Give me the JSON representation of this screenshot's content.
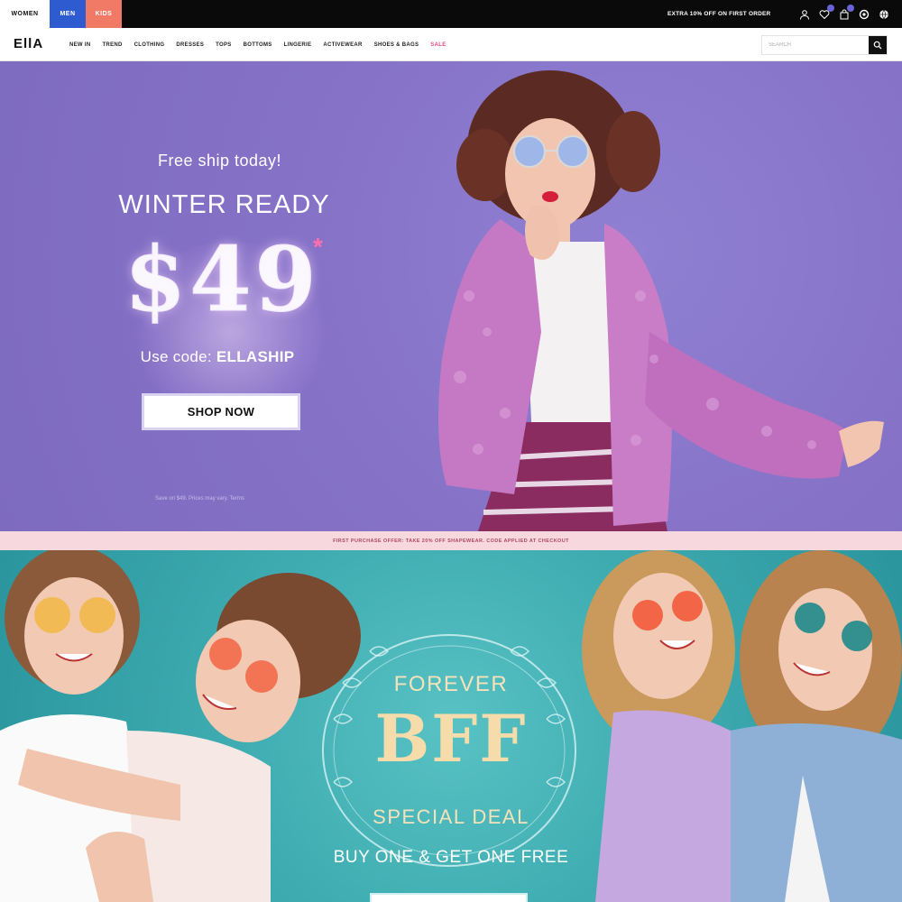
{
  "topbar": {
    "tabs": [
      {
        "label": "WOMEN",
        "color": "#ffffff"
      },
      {
        "label": "MEN",
        "color": "#2f5bd1"
      },
      {
        "label": "KIDS",
        "color": "#f07a66"
      }
    ],
    "promo": "EXTRA 10% OFF ON FIRST ORDER",
    "icons": [
      "user-icon",
      "heart-icon",
      "cart-icon",
      "headset-icon",
      "globe-icon"
    ]
  },
  "nav": {
    "logo": "EllA",
    "links": [
      "NEW IN",
      "TREND",
      "CLOTHING",
      "DRESSES",
      "TOPS",
      "BOTTOMS",
      "LINGERIE",
      "ACTIVEWEAR",
      "SHOES & BAGS",
      "SALE"
    ],
    "search_placeholder": "SEARCH"
  },
  "hero": {
    "subtitle": "Free ship today!",
    "title": "WINTER READY",
    "price": "$49",
    "price_mark": "*",
    "code_label": "Use code:",
    "code": "ELLASHIP",
    "button": "SHOP NOW",
    "fineprint": "Save on $49. Prices may vary. Terms",
    "accent": "#8673c8"
  },
  "promo_strip": "FIRST PURCHASE OFFER: TAKE 20% OFF SHAPEWEAR. CODE APPLIED AT CHECKOUT",
  "bff": {
    "line1": "FOREVER",
    "big": "BFF",
    "line2": "SPECIAL DEAL",
    "offer": "BUY ONE & GET ONE FREE",
    "accent": "#3eacb1"
  }
}
